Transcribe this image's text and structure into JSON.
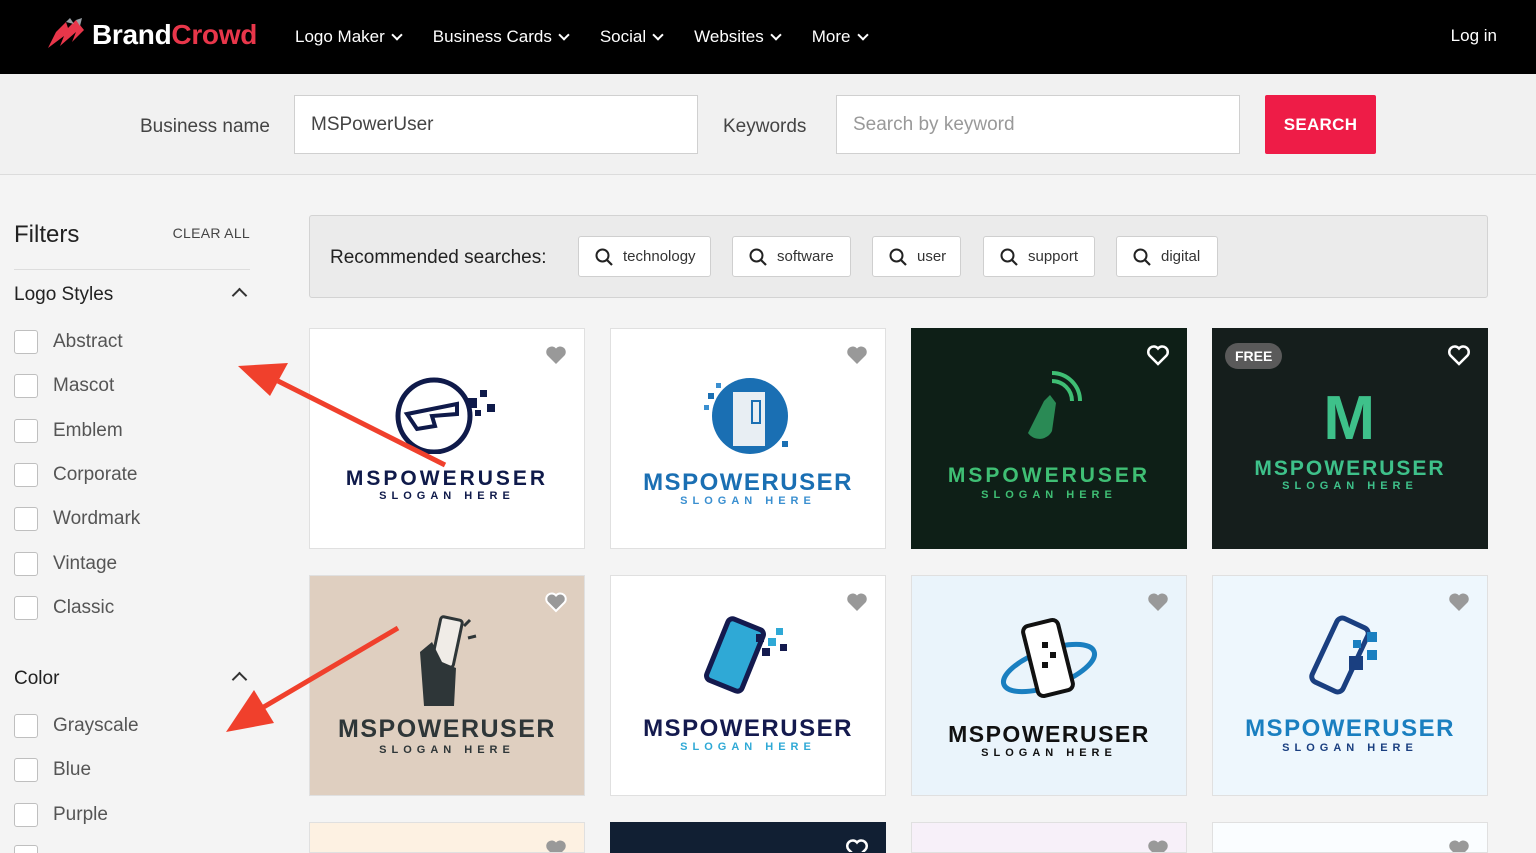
{
  "brand": {
    "name_part1": "Brand",
    "name_part2": "Crowd"
  },
  "nav": {
    "items": [
      "Logo Maker",
      "Business Cards",
      "Social",
      "Websites",
      "More"
    ],
    "login": "Log in"
  },
  "search": {
    "business_label": "Business name",
    "business_value": "MSPowerUser",
    "keywords_label": "Keywords",
    "keywords_placeholder": "Search by keyword",
    "button": "SEARCH"
  },
  "filters": {
    "title": "Filters",
    "clear_all": "CLEAR ALL",
    "logo_styles": {
      "title": "Logo Styles",
      "options": [
        "Abstract",
        "Mascot",
        "Emblem",
        "Corporate",
        "Wordmark",
        "Vintage",
        "Classic"
      ]
    },
    "color": {
      "title": "Color",
      "options": [
        "Grayscale",
        "Blue",
        "Purple"
      ]
    }
  },
  "recommended": {
    "title": "Recommended searches:",
    "chips": [
      "technology",
      "software",
      "user",
      "support",
      "digital"
    ]
  },
  "cards": [
    {
      "wordmark": "MSPOWERUSER",
      "slogan": "SLOGAN HERE",
      "bg": "#ffffff",
      "word_color": "#0f1a4a",
      "slogan_color": "#0f1a4a"
    },
    {
      "wordmark": "MSPOWERUSER",
      "slogan": "SLOGAN HERE",
      "bg": "#ffffff",
      "word_color": "#1a6fb3",
      "slogan_color": "#3a8fd0"
    },
    {
      "wordmark": "MSPOWERUSER",
      "slogan": "SLOGAN HERE",
      "bg": "#0e1f17",
      "word_color": "#3fbf74",
      "slogan_color": "#3fbf74"
    },
    {
      "wordmark": "MSPOWERUSER",
      "slogan": "SLOGAN HERE",
      "bg": "#151e1c",
      "word_color": "#3ec18a",
      "slogan_color": "#3ec18a",
      "free": "FREE",
      "initial": "M"
    },
    {
      "wordmark": "MSPOWERUSER",
      "slogan": "SLOGAN HERE",
      "bg": "#dfcfc0",
      "word_color": "#2e3638",
      "slogan_color": "#2e3638"
    },
    {
      "wordmark": "MSPOWERUSER",
      "slogan": "SLOGAN HERE",
      "bg": "#ffffff",
      "word_color": "#141a4e",
      "slogan_color": "#2fa9d6"
    },
    {
      "wordmark": "MSPOWERUSER",
      "slogan": "SLOGAN HERE",
      "bg": "#eaf4fb",
      "word_color": "#111111",
      "slogan_color": "#111111"
    },
    {
      "wordmark": "MSPOWERUSER",
      "slogan": "SLOGAN HERE",
      "bg": "#eef7fd",
      "word_color": "#1a7fc0",
      "slogan_color": "#1a3f80"
    }
  ],
  "colors": {
    "accent": "#ee1c47",
    "brand_red": "#e8364a",
    "arrow": "#f0402c"
  }
}
